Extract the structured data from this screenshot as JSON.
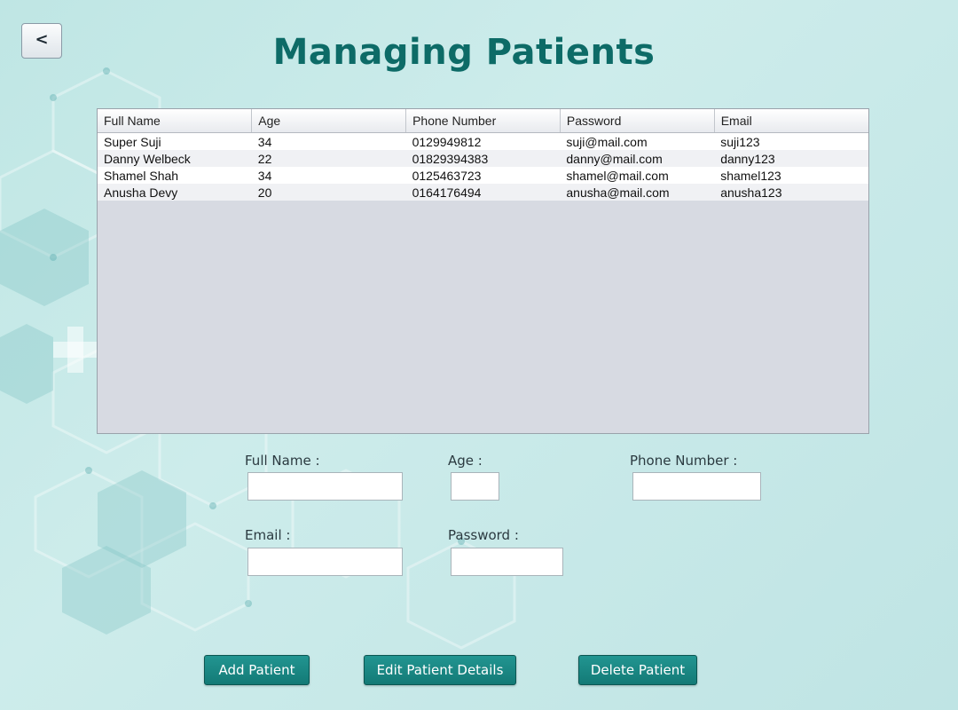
{
  "nav": {
    "back_label": "<"
  },
  "page": {
    "title": "Managing Patients"
  },
  "table": {
    "columns": [
      "Full Name",
      "Age",
      "Phone Number",
      "Password",
      "Email"
    ],
    "rows": [
      [
        "Super Suji",
        "34",
        "0129949812",
        "suji@mail.com",
        "suji123"
      ],
      [
        "Danny Welbeck",
        "22",
        "01829394383",
        "danny@mail.com",
        "danny123"
      ],
      [
        "Shamel Shah",
        "34",
        "0125463723",
        "shamel@mail.com",
        "shamel123"
      ],
      [
        "Anusha Devy",
        "20",
        "0164176494",
        "anusha@mail.com",
        "anusha123"
      ]
    ]
  },
  "form": {
    "full_name_label": "Full Name :",
    "full_name_value": "",
    "age_label": "Age :",
    "age_value": "",
    "phone_label": "Phone Number :",
    "phone_value": "",
    "email_label": "Email :",
    "email_value": "",
    "password_label": "Password :",
    "password_value": ""
  },
  "actions": {
    "add_label": "Add Patient",
    "edit_label": "Edit Patient Details",
    "delete_label": "Delete Patient"
  },
  "colors": {
    "accent": "#0d6b67",
    "button": "#1a8a86",
    "background": "#c6e9e7"
  }
}
